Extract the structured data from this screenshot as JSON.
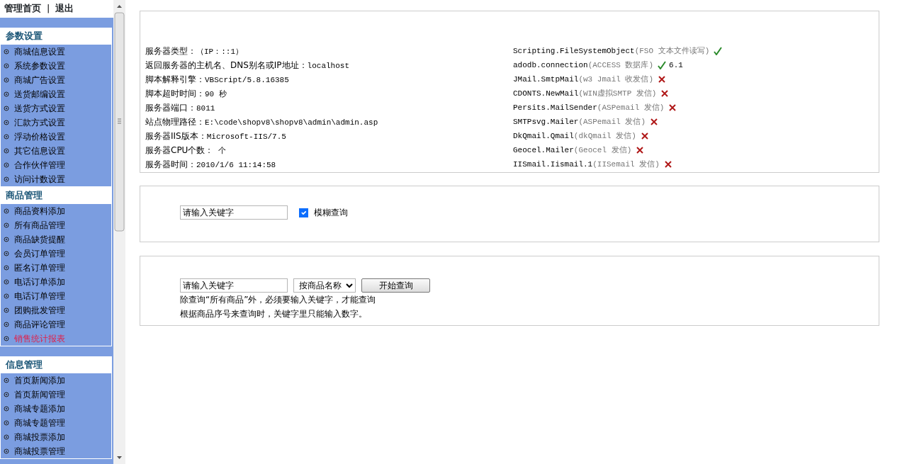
{
  "top_links": [
    "管理首页",
    "退出"
  ],
  "top_separator": "|",
  "sidebar": {
    "sections": [
      {
        "title": "参数设置",
        "items": [
          {
            "label": "商城信息设置",
            "selected": false
          },
          {
            "label": "系统参数设置",
            "selected": false
          },
          {
            "label": "商城广告设置",
            "selected": false
          },
          {
            "label": "送货邮编设置",
            "selected": false
          },
          {
            "label": "送货方式设置",
            "selected": false
          },
          {
            "label": "汇款方式设置",
            "selected": false
          },
          {
            "label": "浮动价格设置",
            "selected": false
          },
          {
            "label": "其它信息设置",
            "selected": false
          },
          {
            "label": "合作伙伴管理",
            "selected": false
          },
          {
            "label": "访问计数设置",
            "selected": false
          }
        ]
      },
      {
        "title": "商品管理",
        "items": [
          {
            "label": "商品资料添加",
            "selected": false
          },
          {
            "label": "所有商品管理",
            "selected": false
          },
          {
            "label": "商品缺货提醒",
            "selected": false
          },
          {
            "label": "会员订单管理",
            "selected": false
          },
          {
            "label": "匿名订单管理",
            "selected": false
          },
          {
            "label": "电话订单添加",
            "selected": false
          },
          {
            "label": "电话订单管理",
            "selected": false
          },
          {
            "label": "团购批发管理",
            "selected": false
          },
          {
            "label": "商品评论管理",
            "selected": false
          },
          {
            "label": "销售统计报表",
            "selected": true
          }
        ]
      },
      {
        "title": "信息管理",
        "items": [
          {
            "label": "首页新闻添加",
            "selected": false
          },
          {
            "label": "首页新闻管理",
            "selected": false
          },
          {
            "label": "商城专题添加",
            "selected": false
          },
          {
            "label": "商城专题管理",
            "selected": false
          },
          {
            "label": "商城投票添加",
            "selected": false
          },
          {
            "label": "商城投票管理",
            "selected": false
          }
        ]
      }
    ]
  },
  "server_info": [
    {
      "label": "服务器类型：",
      "value": "（IP：::1）"
    },
    {
      "label": "返回服务器的主机名、DNS别名或IP地址：",
      "value": "localhost"
    },
    {
      "label": "脚本解释引擎：",
      "value": "VBScript/5.8.16385"
    },
    {
      "label": "脚本超时时间：",
      "value": "90 秒"
    },
    {
      "label": "服务器端口：",
      "value": "8011"
    },
    {
      "label": "站点物理路径：",
      "value": "E:\\code\\shopv8\\shopv8\\admin\\admin.asp"
    },
    {
      "label": "服务器IIS版本：",
      "value": "Microsoft-IIS/7.5"
    },
    {
      "label": "服务器CPU个数：",
      "value": " 个"
    },
    {
      "label": "服务器时间：",
      "value": "2010/1/6 11:14:58"
    }
  ],
  "components": [
    {
      "name": "Scripting.FileSystemObject",
      "note": "(FSO 文本文件读写)",
      "supported": true
    },
    {
      "name": "adodb.connection",
      "note": "(ACCESS 数据库)",
      "supported": true,
      "version": "6.1"
    },
    {
      "name": "JMail.SmtpMail",
      "note": "(w3 Jmail 收发信)",
      "supported": false
    },
    {
      "name": "CDONTS.NewMail",
      "note": "(WIN虚拟SMTP 发信)",
      "supported": false
    },
    {
      "name": "Persits.MailSender",
      "note": "(ASPemail 发信)",
      "supported": false
    },
    {
      "name": "SMTPsvg.Mailer",
      "note": "(ASPemail 发信)",
      "supported": false
    },
    {
      "name": "DkQmail.Qmail",
      "note": "(dkQmail 发信)",
      "supported": false
    },
    {
      "name": "Geocel.Mailer",
      "note": "(Geocel 发信)",
      "supported": false
    },
    {
      "name": "IISmail.Iismail.1",
      "note": "(IISemail 发信)",
      "supported": false
    }
  ],
  "search1": {
    "keyword": "请输入关键字",
    "fuzzy": {
      "label": "模糊查询",
      "checked": true
    }
  },
  "search2": {
    "keyword": "请输入关键字",
    "field": "按商品名称",
    "button": "开始查询",
    "notes": [
      "除查询“所有商品”外，必须要输入关键字，才能查询",
      "根据商品序号来查询时，关键字里只能输入数字。"
    ]
  }
}
